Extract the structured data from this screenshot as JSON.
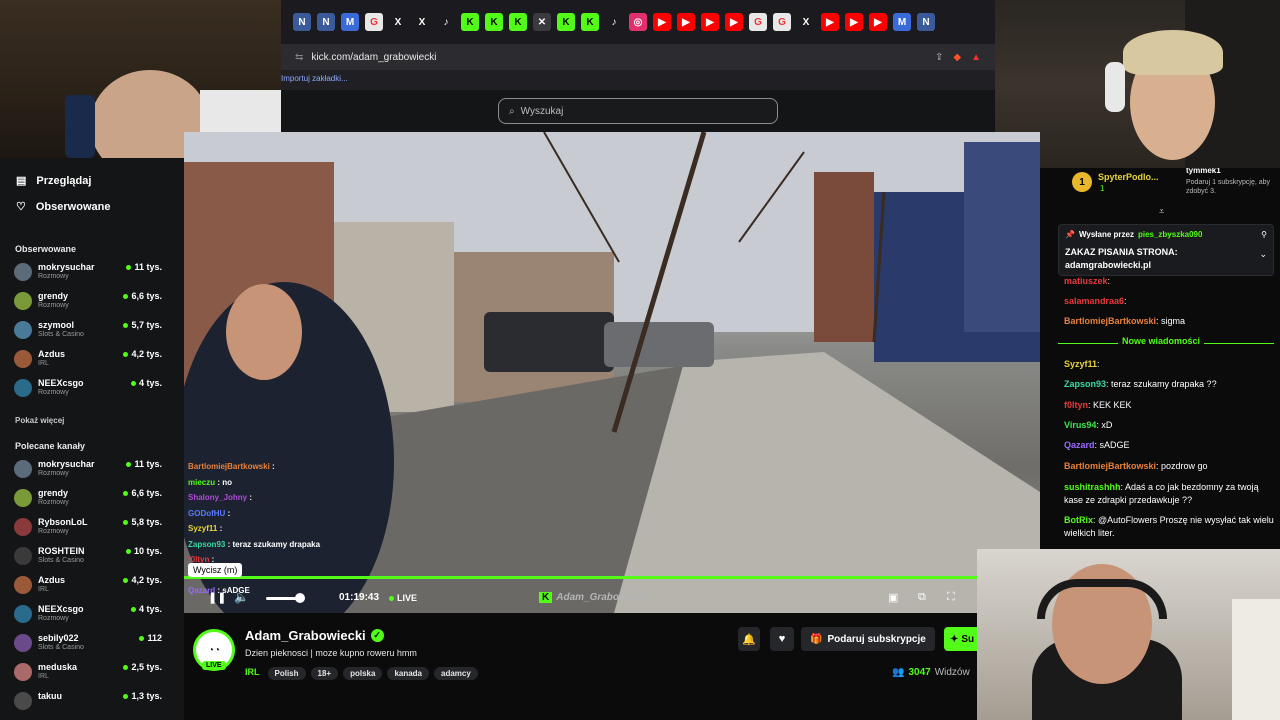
{
  "browser": {
    "url": "kick.com/adam_grabowiecki",
    "bookmark_label": "Importuj zakładki...",
    "tabs": [
      "N",
      "N",
      "M",
      "G",
      "X",
      "X",
      "♪",
      "K",
      "K",
      "K",
      "✕",
      "K",
      "K",
      "♪",
      "◎",
      "▶",
      "▶",
      "▶",
      "▶",
      "G",
      "G",
      "X",
      "▶",
      "▶",
      "▶",
      "M",
      "N"
    ]
  },
  "kick": {
    "search_placeholder": "Wyszukaj"
  },
  "sidebar": {
    "nav": [
      {
        "label": "Przeglądaj"
      },
      {
        "label": "Obserwowane"
      }
    ],
    "followed_title": "Obserwowane",
    "followed": [
      {
        "name": "mokrysuchar",
        "category": "Rozmowy",
        "viewers": "11 tys.",
        "color": "#5b6b7a"
      },
      {
        "name": "grendy",
        "category": "Rozmowy",
        "viewers": "6,6 tys.",
        "color": "#7a9a3a"
      },
      {
        "name": "szymool",
        "category": "Slots & Casino",
        "viewers": "5,7 tys.",
        "color": "#4a7a9a"
      },
      {
        "name": "Azdus",
        "category": "IRL",
        "viewers": "4,2 tys.",
        "color": "#9a5a3a"
      },
      {
        "name": "NEEXcsgo",
        "category": "Rozmowy",
        "viewers": "4 tys.",
        "color": "#2a6a8a"
      }
    ],
    "show_more": "Pokaż więcej",
    "recommended_title": "Polecane kanały",
    "recommended": [
      {
        "name": "mokrysuchar",
        "category": "Rozmowy",
        "viewers": "11 tys.",
        "color": "#5b6b7a"
      },
      {
        "name": "grendy",
        "category": "Rozmowy",
        "viewers": "6,6 tys.",
        "color": "#7a9a3a"
      },
      {
        "name": "RybsonLoL",
        "category": "Rozmowy",
        "viewers": "5,8 tys.",
        "color": "#8a3a3a"
      },
      {
        "name": "ROSHTEIN",
        "category": "Slots & Casino",
        "viewers": "10 tys.",
        "color": "#3a3a3a"
      },
      {
        "name": "Azdus",
        "category": "IRL",
        "viewers": "4,2 tys.",
        "color": "#9a5a3a"
      },
      {
        "name": "NEEXcsgo",
        "category": "Rozmowy",
        "viewers": "4 tys.",
        "color": "#2a6a8a"
      },
      {
        "name": "sebily022",
        "category": "Slots & Casino",
        "viewers": "112",
        "color": "#6a4a8a"
      },
      {
        "name": "meduska",
        "category": "IRL",
        "viewers": "2,5 tys.",
        "color": "#aa6a6a"
      },
      {
        "name": "takuu",
        "category": "",
        "viewers": "1,3 tys.",
        "color": "#4a4a4a"
      }
    ]
  },
  "overlay_chat": [
    {
      "user": "BartlomiejBartkowski",
      "text": ":",
      "color": "#e8803a"
    },
    {
      "user": "mieczu",
      "text": ": no",
      "color": "#53fc18"
    },
    {
      "user": "Shalony_Johny",
      "text": ":",
      "color": "#b04ad8"
    },
    {
      "user": "GODofHU",
      "text": ":",
      "color": "#5a7aff"
    },
    {
      "user": "Syzyf11",
      "text": ":",
      "color": "#e8d43a"
    },
    {
      "user": "Zapson93",
      "text": ": teraz szukamy drapaka",
      "color": "#3ad8a0"
    },
    {
      "user": "f0ltyn",
      "text": ":",
      "color": "#e83a3a"
    },
    {
      "user": "Virus94",
      "text": "",
      "color": "#3ae84a"
    },
    {
      "user": "Qazard",
      "text": ": sADGE",
      "color": "#9a6aff"
    }
  ],
  "player": {
    "tooltip": "Wycisz (m)",
    "time": "01:19:43",
    "live_label": "LIVE",
    "watermark": "Adam_Grabowiecki"
  },
  "stream": {
    "streamer": "Adam_Grabowiecki",
    "title": "Dzien pieknosci | moze kupno roweru hmm",
    "category": "IRL",
    "tags": [
      "Polish",
      "18+",
      "polska",
      "kanada",
      "adamcy"
    ],
    "live_badge": "LIVE",
    "gift_label": "Podaruj subskrypcje",
    "sub_label": "Su",
    "viewers": "3047",
    "viewers_label": "Widzów"
  },
  "chat": {
    "gifter": "SpyterPodlo...",
    "gifter_rank": "1",
    "gifter_count": "1",
    "top_user": "tymmek1",
    "top_note": "Podaruj 1 subskrypcję, aby zdobyć 3.",
    "pinned_by_label": "Wysłane przez",
    "pinned_user": "pies_zbyszka090",
    "pinned_text": "ZAKAZ PISANIA STRONA: adamgrabowiecki.pl",
    "new_messages_label": "Nowe wiadomości",
    "messages_top": [
      {
        "user": "matiuszek",
        "text": ":",
        "color": "#e83a3a"
      },
      {
        "user": "salamandraa6",
        "text": ":",
        "color": "#e83a3a"
      },
      {
        "user": "BartlomiejBartkowski",
        "text": ": sigma",
        "color": "#e8803a"
      }
    ],
    "messages": [
      {
        "user": "Syzyf11",
        "text": ":",
        "color": "#e8d43a"
      },
      {
        "user": "Zapson93",
        "text": ": teraz szukamy drapaka ??",
        "color": "#3ad8a0"
      },
      {
        "user": "f0ltyn",
        "text": ": KEK KEK",
        "color": "#e83a3a"
      },
      {
        "user": "Virus94",
        "text": ": xD",
        "color": "#3ae84a"
      },
      {
        "user": "Qazard",
        "text": ": sADGE",
        "color": "#9a6aff"
      },
      {
        "user": "BartlomiejBartkowski",
        "text": ": pozdrow go",
        "color": "#e8803a"
      },
      {
        "user": "sushitrashhh",
        "text": ": Adaś a co jak bezdomny za twoją kase ze zdrapki przedawkuje ??",
        "color": "#53fc18"
      },
      {
        "user": "BotRix",
        "text": ": @AutoFlowers Proszę nie wysyłać tak wielu wielkich liter.",
        "color": "#53fc18"
      }
    ]
  }
}
